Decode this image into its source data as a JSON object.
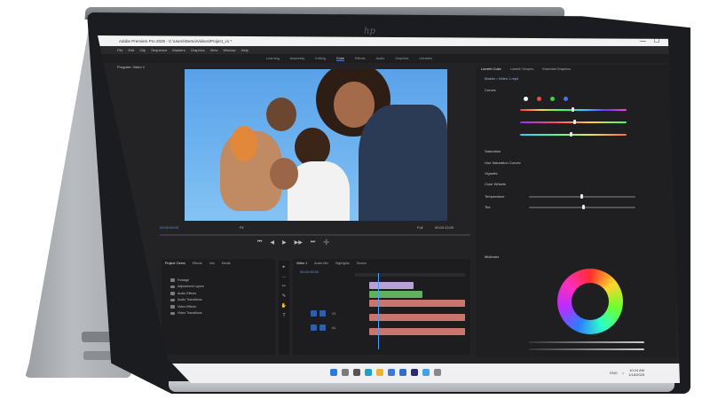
{
  "window": {
    "title": "Adobe Premiere Pro 2025 - C:\\Users\\Demo\\Videos\\Project_v1 *",
    "controls": [
      "—",
      "☐",
      "✕"
    ]
  },
  "menu": [
    "File",
    "Edit",
    "Clip",
    "Sequence",
    "Markers",
    "Graphics",
    "View",
    "Window",
    "Help"
  ],
  "workspaces": [
    "Learning",
    "Assembly",
    "Editing",
    "Color",
    "Effects",
    "Audio",
    "Graphics",
    "Libraries"
  ],
  "workspace_active": "Color",
  "program_monitor": {
    "label": "Program: Video 1",
    "timecode_current": "00:00:05:00",
    "timecode_duration": "00:00:13:00",
    "fit": "Fit",
    "quality": "Full",
    "transport": [
      "⏮",
      "◀",
      "▶",
      "▶▶",
      "⏭",
      "➕"
    ]
  },
  "lumetri": {
    "tabs": [
      "Lumetri Color",
      "Lumetri Scopes",
      "Essential Graphics"
    ],
    "active_tab": "Lumetri Color",
    "source_label": "Master • Video 1.mp4",
    "rows": [
      "Curves",
      "Saturation",
      "Hue Saturation Curves",
      "Vignette",
      "Color Wheels",
      "Temperature",
      "Tint"
    ],
    "wheel_label": "Midtones",
    "colors": {
      "accent": "#4d9aff",
      "panel": "#1f1f22"
    }
  },
  "project": {
    "tabs": [
      "Project: Demo",
      "Effects",
      "Info",
      "Media"
    ],
    "active_tab": "Project: Demo",
    "items": [
      "Footage",
      "Adjustment Layers",
      "Audio Effects",
      "Audio Transitions",
      "Video Effects",
      "Video Transitions"
    ]
  },
  "tools": [
    "▸",
    "↔",
    "✂",
    "✎",
    "✋",
    "T"
  ],
  "timeline": {
    "tabs": [
      "Video 1",
      "Audio Mix",
      "Highlights",
      "Source"
    ],
    "active_tab": "Video 1",
    "timecode": "00:00:05:00",
    "tracks": [
      "V3",
      "V2",
      "V1",
      "A1",
      "A2"
    ],
    "clip_colors": [
      "#b79fd8",
      "#5fb15f",
      "#c9756b",
      "#c9756b",
      "#c9756b"
    ]
  },
  "taskbar": {
    "icons": [
      "start",
      "search",
      "task-view",
      "edge",
      "explorer",
      "store",
      "mail",
      "premiere",
      "photos",
      "settings"
    ],
    "tray_time": "10:24 AM",
    "tray_date": "1/16/2025",
    "tray_lang": "ENG"
  },
  "brand": {
    "logo": "hp"
  }
}
